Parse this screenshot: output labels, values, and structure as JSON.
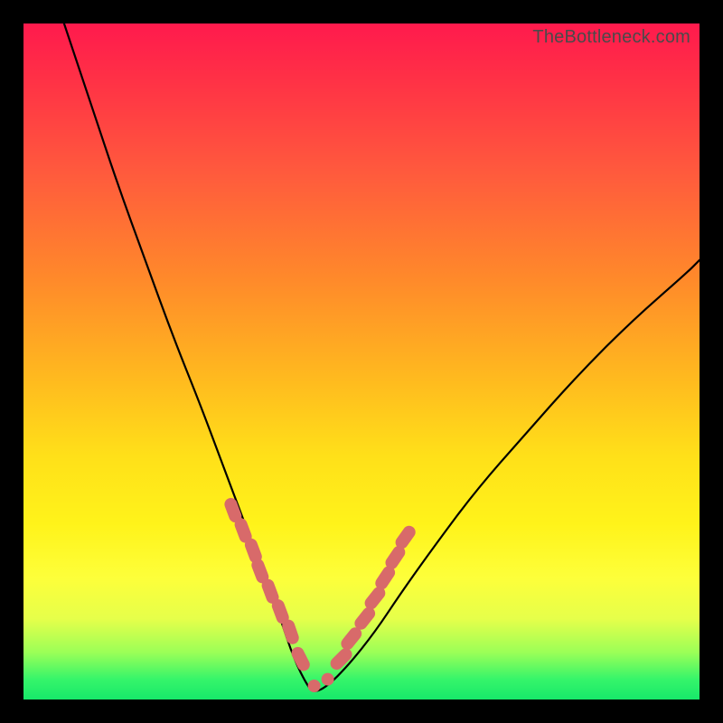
{
  "watermark": "TheBottleneck.com",
  "colors": {
    "frame": "#000000",
    "gradient_top": "#ff1a4d",
    "gradient_mid": "#ffe019",
    "gradient_bottom": "#17e86a",
    "curve": "#000000",
    "dots": "#d86a6a"
  },
  "chart_data": {
    "type": "line",
    "title": "",
    "xlabel": "",
    "ylabel": "",
    "xlim": [
      0,
      100
    ],
    "ylim": [
      0,
      100
    ],
    "grid": false,
    "legend": false,
    "note": "V-shaped bottleneck curve on red→green vertical gradient; minimum near x≈43; axes are unlabeled so values are normalized 0–100 estimates read from position.",
    "series": [
      {
        "name": "bottleneck-curve",
        "x": [
          6,
          10,
          14,
          18,
          22,
          26,
          29,
          32,
          35,
          38,
          40,
          42,
          43,
          45,
          48,
          52,
          56,
          61,
          67,
          74,
          82,
          90,
          98,
          100
        ],
        "y": [
          100,
          88,
          76,
          65,
          54,
          44,
          36,
          28,
          20,
          12,
          6,
          2,
          1,
          2,
          5,
          10,
          16,
          23,
          31,
          39,
          48,
          56,
          63,
          65
        ]
      }
    ],
    "scatter": {
      "name": "highlight-dots",
      "note": "Coral dots clustered near the valley on both flanks of the curve; positions estimated.",
      "x": [
        31,
        32.5,
        34,
        35,
        36.5,
        38,
        39.5,
        41,
        43,
        45,
        47,
        48.5,
        50.5,
        52,
        53.5,
        55,
        56.5
      ],
      "y": [
        28,
        25,
        22,
        19,
        16,
        13,
        10,
        6,
        2,
        3,
        6,
        9,
        12,
        15,
        18,
        21,
        24
      ]
    }
  }
}
